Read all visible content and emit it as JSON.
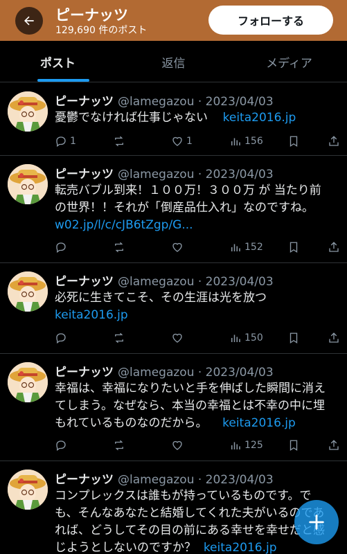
{
  "header": {
    "title": "ピーナッツ",
    "subtitle": "129,690 件のポスト",
    "follow_label": "フォローする",
    "accent_color": "#b26a33"
  },
  "tabs": [
    {
      "label": "ポスト",
      "active": true
    },
    {
      "label": "返信",
      "active": false
    },
    {
      "label": "メディア",
      "active": false
    }
  ],
  "posts": [
    {
      "name": "ピーナッツ",
      "meta": "@lamegazou · 2023/04/03",
      "lines": [
        "憂鬱でなければ仕事じゃない"
      ],
      "inline_link": "keita2016.jp",
      "replies": "1",
      "reposts": "",
      "likes": "1",
      "views": "156"
    },
    {
      "name": "ピーナッツ",
      "meta": "@lamegazou · 2023/04/03",
      "lines": [
        "転売バブル到来！１００万！３００万 が 当たり前",
        "の世界！！それが「倒産品仕入れ」なのですね。"
      ],
      "link": "w02.jp/l/c/cJB6tZgp/G...",
      "replies": "",
      "reposts": "",
      "likes": "",
      "views": "152"
    },
    {
      "name": "ピーナッツ",
      "meta": "@lamegazou · 2023/04/03",
      "lines": [
        "必死に生きてこそ、その生涯は光を放つ"
      ],
      "link": "keita2016.jp",
      "replies": "",
      "reposts": "",
      "likes": "",
      "views": "150"
    },
    {
      "name": "ピーナッツ",
      "meta": "@lamegazou · 2023/04/03",
      "lines": [
        "幸福は、幸福になりたいと手を伸ばした瞬間に消え",
        "てしまう。なぜなら、本当の幸福とは不幸の中に埋",
        "もれているものなのだから。"
      ],
      "inline_link": "keita2016.jp",
      "replies": "",
      "reposts": "",
      "likes": "",
      "views": "125"
    },
    {
      "name": "ピーナッツ",
      "meta": "@lamegazou · 2023/04/03",
      "lines": [
        "コンプレックスは誰もが持っているものです。で",
        "も、そんなあなたと結婚してくれた夫がいるのであ",
        "れば、どうしてその目の前にある幸せを幸せだと感",
        "じようとしないのですか？"
      ],
      "inline_link": "keita2016.jp"
    }
  ]
}
